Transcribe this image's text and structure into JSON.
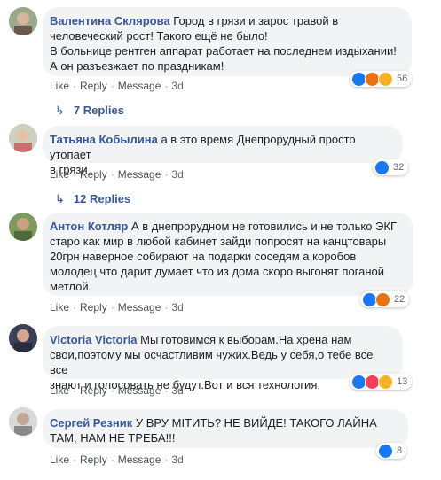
{
  "comments": [
    {
      "author": "Валентина Склярова",
      "text_lines": [
        "Город в грязи и зарос травой в",
        "человеческий рост! Такого ещё не было!",
        "В больнице рентген аппарат работает на последнем издыхании!",
        "А он разъезжает по праздникам!"
      ],
      "reaction_count": "56",
      "time": "3d",
      "replies": "7 Replies"
    },
    {
      "author": "Татьяна Кобылина",
      "text_lines": [
        "а в это время Днепрорудный просто утопает",
        "в грязи"
      ],
      "reaction_count": "32",
      "time": "3d",
      "replies": "12 Replies"
    },
    {
      "author": "Антон Котляр",
      "text_lines": [
        "А в днепрорудном не готовились и не только ЭКГ",
        "старо как мир в любой кабинет зайди попросят на канцтовары",
        "20грн наверное собирают на подарки соседям а коробов",
        "молодец что дарит думает что из дома скоро выгонят поганой",
        "метлой"
      ],
      "reaction_count": "22",
      "time": "3d"
    },
    {
      "author": "Victoria Victoria",
      "text_lines": [
        "Мы готовимся к выборам.На хрена нам",
        "свои,поэтому мы осчастливим чужих.Ведь у себя,о тебе все все",
        "знают и голосовать не будут.Вот и вся технология."
      ],
      "reaction_count": "13",
      "time": "3d"
    },
    {
      "author": "Сергей Резник",
      "text_lines": [
        "У ВРУ МІТИТЬ? НЕ ВИЙДЕ! ТАКОГО ЛАЙНА",
        "ТАМ, НАМ НЕ ТРЕБА!!!"
      ],
      "reaction_count": "8",
      "time": "3d"
    }
  ],
  "actions": {
    "like": "Like",
    "reply": "Reply",
    "message": "Message",
    "sep": "·"
  },
  "icons": {
    "reply_arrow": "reply-arrow-icon"
  },
  "colors": {
    "author": "#385898",
    "bubble": "#f2f3f5",
    "like": "#1877f2"
  }
}
